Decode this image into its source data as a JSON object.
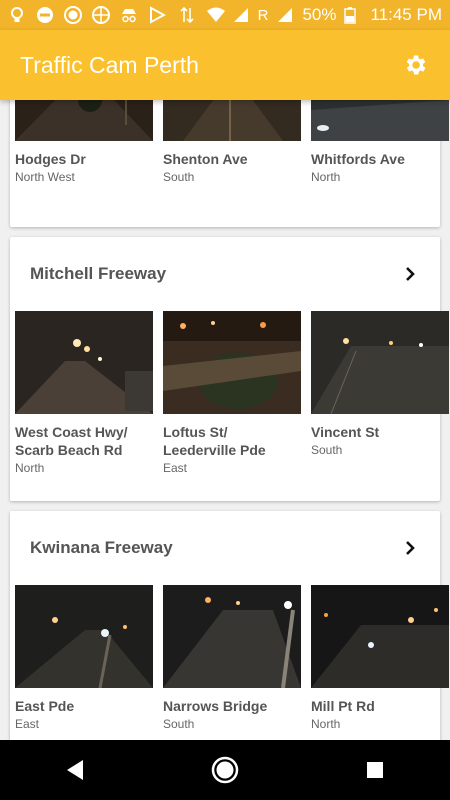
{
  "statusbar": {
    "battery": "50%",
    "time": "11:45 PM",
    "network": "R"
  },
  "app": {
    "title": "Traffic Cam Perth"
  },
  "top_section": {
    "cams": [
      {
        "name": "Hodges Dr",
        "direction": "North West"
      },
      {
        "name": "Shenton Ave",
        "direction": "South"
      },
      {
        "name": "Whitfords Ave",
        "direction": "North"
      }
    ]
  },
  "sections": [
    {
      "title": "Mitchell Freeway",
      "cams": [
        {
          "name": "West Coast Hwy/ Scarb Beach Rd",
          "direction": "North"
        },
        {
          "name": "Loftus St/ Leederville Pde",
          "direction": "East"
        },
        {
          "name": "Vincent St",
          "direction": "South"
        }
      ]
    },
    {
      "title": "Kwinana Freeway",
      "cams": [
        {
          "name": "East Pde",
          "direction": "East"
        },
        {
          "name": "Narrows Bridge",
          "direction": "South"
        },
        {
          "name": "Mill Pt Rd",
          "direction": "North"
        }
      ]
    }
  ],
  "colors": {
    "appbar": "#fbc02d",
    "statusbar": "#f2b42a",
    "card_title": "#555555"
  }
}
